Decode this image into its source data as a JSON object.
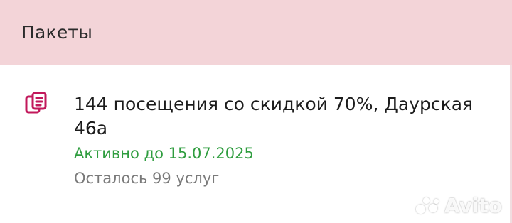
{
  "header": {
    "title": "Пакеты"
  },
  "package": {
    "icon": "package-stack-icon",
    "title": "144 посещения со скидкой 70%, Даурская 46а",
    "status": "Активно до 15.07.2025",
    "remaining": "Осталось 99 услуг",
    "accent_color": "#c2185b",
    "status_color": "#2f9d3f"
  },
  "watermark": {
    "text": "Avito"
  }
}
